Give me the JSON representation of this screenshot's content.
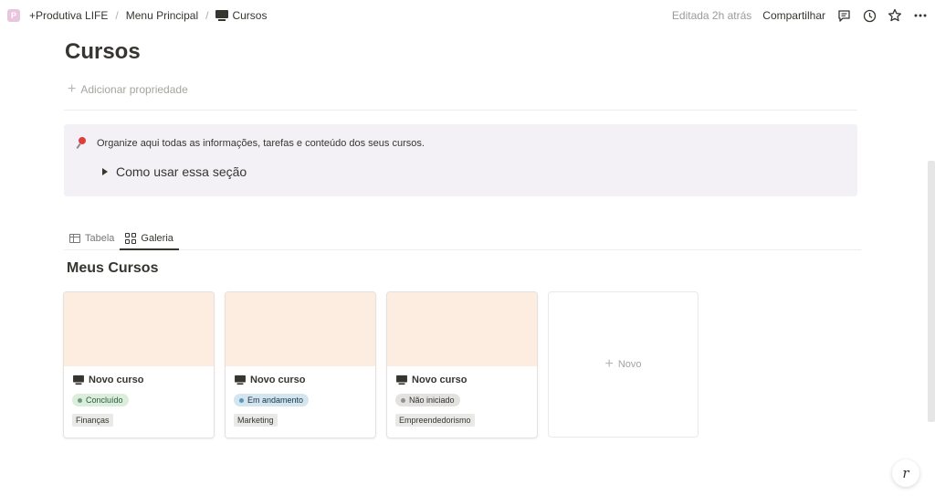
{
  "breadcrumb": {
    "workspace_initial": "P",
    "workspace": "+Produtiva LIFE",
    "sep1": "/",
    "parent": "Menu Principal",
    "sep2": "/",
    "current": "Cursos"
  },
  "topbar": {
    "edited": "Editada 2h atrás",
    "share": "Compartilhar"
  },
  "page": {
    "title": "Cursos",
    "add_property": "Adicionar propriedade"
  },
  "callout": {
    "text": "Organize aqui todas as informações, tarefas e conteúdo dos seus cursos.",
    "toggle": "Como usar essa seção"
  },
  "tabs": [
    {
      "label": "Tabela",
      "active": false
    },
    {
      "label": "Galeria",
      "active": true
    }
  ],
  "section_title": "Meus Cursos",
  "cards": [
    {
      "title": "Novo curso",
      "status": "Concluído",
      "status_bg": "#dbeddb",
      "status_color": "#2b593f",
      "status_dot": "#6c9b7d",
      "category": "Finanças"
    },
    {
      "title": "Novo curso",
      "status": "Em andamento",
      "status_bg": "#d3e5ef",
      "status_color": "#183347",
      "status_dot": "#5b97bd",
      "category": "Marketing"
    },
    {
      "title": "Novo curso",
      "status": "Não iniciado",
      "status_bg": "#e3e2e0",
      "status_color": "#32302c",
      "status_dot": "#91918e",
      "category": "Empreendedorismo"
    }
  ],
  "new_card": "Novo",
  "colors": {
    "cover": "#fdece0",
    "callout_bg": "#f4f1f6"
  }
}
